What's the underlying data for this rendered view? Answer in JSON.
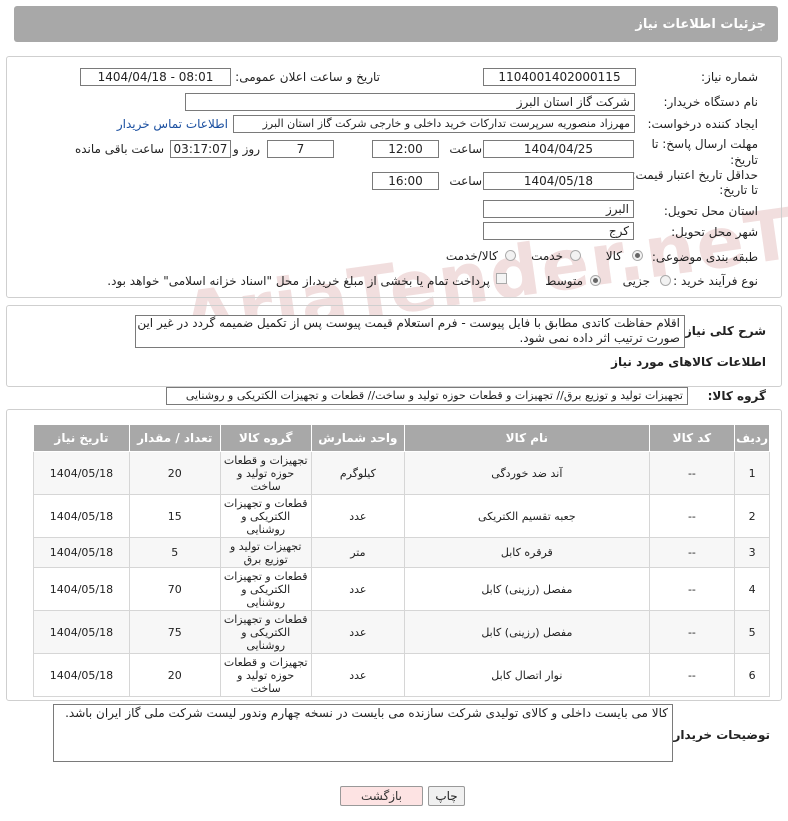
{
  "header": {
    "title": "جزئیات اطلاعات نیاز"
  },
  "watermark": "AriaTender.neT",
  "form": {
    "need_number_label": "شماره نیاز:",
    "need_number": "1104001402000115",
    "announce_label": "تاریخ و ساعت اعلان عمومی:",
    "announce_value": "1404/04/18 - 08:01",
    "buyer_org_label": "نام دستگاه خریدار:",
    "buyer_org": "شرکت گاز استان البرز",
    "creator_label": "ایجاد کننده درخواست:",
    "creator": "مهرزاد منصوریه سرپرست تدارکات خرید داخلی و خارجی شرکت گاز استان البرز",
    "contact_link": "اطلاعات تماس خریدار",
    "deadline_label": "مهلت ارسال پاسخ: تا تاریخ:",
    "deadline_date": "1404/04/25",
    "time_label": "ساعت",
    "deadline_time": "12:00",
    "days": "7",
    "days_label": "روز و",
    "remaining_time": "03:17:07",
    "remaining_label": "ساعت باقی مانده",
    "validity_label": "حداقل تاریخ اعتبار قیمت: تا تاریخ:",
    "validity_date": "1404/05/18",
    "validity_time": "16:00",
    "province_label": "استان محل تحویل:",
    "province": "البرز",
    "city_label": "شهر محل تحویل:",
    "city": "کرج",
    "category_label": "طبقه بندی موضوعی:",
    "cat_goods": "کالا",
    "cat_service": "خدمت",
    "cat_goods_service": "کالا/خدمت",
    "process_label": "نوع فرآیند خرید :",
    "proc_partial": "جزیی",
    "proc_medium": "متوسط",
    "payment_text": "پرداخت تمام یا بخشی از مبلغ خرید،از محل \"اسناد خزانه اسلامی\" خواهد بود.",
    "summary_label": "شرح کلی نیاز:",
    "summary": "اقلام حفاظت کاتدی مطابق با فایل پیوست - فرم استعلام قیمت پیوست پس از تکمیل ضمیمه گردد در غیر این صورت ترتیب اثر داده نمی شود.",
    "items_info_label": "اطلاعات کالاهای مورد نیاز",
    "goods_group_label": "گروه کالا:",
    "goods_group": "تجهیزات تولید و توزیع برق// تجهیزات و قطعات حوزه تولید و ساخت// قطعات و تجهیزات الکتریکی و روشنایی"
  },
  "table": {
    "headers": [
      "ردیف",
      "کد کالا",
      "نام کالا",
      "واحد شمارش",
      "گروه کالا",
      "تعداد / مقدار",
      "تاریخ نیاز"
    ],
    "rows": [
      {
        "idx": "1",
        "code": "--",
        "name": "آند ضد خوردگی",
        "unit": "کیلوگرم",
        "group": "تجهیزات و قطعات حوزه تولید و ساخت",
        "qty": "20",
        "date": "1404/05/18"
      },
      {
        "idx": "2",
        "code": "--",
        "name": "جعبه تقسیم الکتریکی",
        "unit": "عدد",
        "group": "قطعات و تجهیزات الکتریکی و روشنایی",
        "qty": "15",
        "date": "1404/05/18"
      },
      {
        "idx": "3",
        "code": "--",
        "name": "قرقره کابل",
        "unit": "متر",
        "group": "تجهیزات تولید و توزیع برق",
        "qty": "5",
        "date": "1404/05/18"
      },
      {
        "idx": "4",
        "code": "--",
        "name": "مفصل (رزینی) کابل",
        "unit": "عدد",
        "group": "قطعات و تجهیزات الکتریکی و روشنایی",
        "qty": "70",
        "date": "1404/05/18"
      },
      {
        "idx": "5",
        "code": "--",
        "name": "مفصل (رزینی) کابل",
        "unit": "عدد",
        "group": "قطعات و تجهیزات الکتریکی و روشنایی",
        "qty": "75",
        "date": "1404/05/18"
      },
      {
        "idx": "6",
        "code": "--",
        "name": "نوار اتصال کابل",
        "unit": "عدد",
        "group": "تجهیزات و قطعات حوزه تولید و ساخت",
        "qty": "20",
        "date": "1404/05/18"
      }
    ]
  },
  "buyer_notes_label": "توضیحات خریدار:",
  "buyer_notes": "کالا می بایست داخلی و کالای تولیدی شرکت سازنده می بایست در نسخه چهارم وندور لیست شرکت ملی گاز ایران باشد.",
  "buttons": {
    "print": "چاپ",
    "back": "بازگشت"
  }
}
